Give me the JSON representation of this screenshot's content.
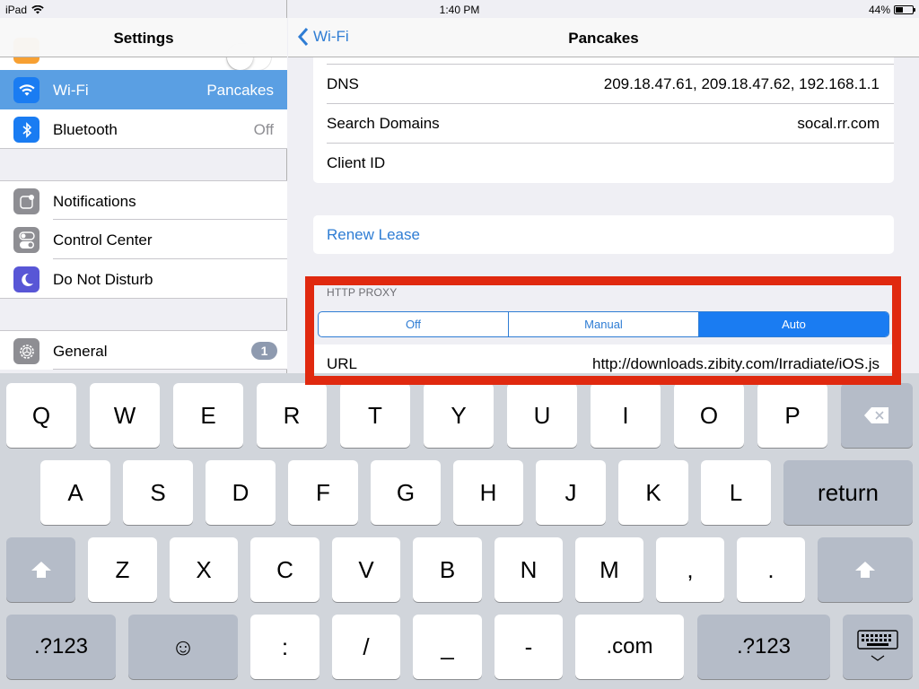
{
  "status_bar": {
    "device": "iPad",
    "time": "1:40 PM",
    "battery_percent_label": "44%",
    "battery_level": 0.44
  },
  "sidebar": {
    "title": "Settings",
    "items": [
      {
        "label": "Wi-Fi",
        "value": "Pancakes",
        "icon": "wifi-icon",
        "color": "#1a7cf2",
        "selected": true
      },
      {
        "label": "Bluetooth",
        "value": "Off",
        "icon": "bluetooth-icon",
        "color": "#1a7cf2"
      },
      {
        "label": "Notifications",
        "icon": "notifications-icon",
        "color": "#8e8e93"
      },
      {
        "label": "Control Center",
        "icon": "control-center-icon",
        "color": "#8e8e93"
      },
      {
        "label": "Do Not Disturb",
        "icon": "moon-icon",
        "color": "#5856d6"
      },
      {
        "label": "General",
        "badge": "1",
        "icon": "gear-icon",
        "color": "#8e8e93"
      }
    ]
  },
  "detail": {
    "back_label": "Wi-Fi",
    "title": "Pancakes",
    "rows": [
      {
        "label": "DNS",
        "value": "209.18.47.61, 209.18.47.62, 192.168.1.1"
      },
      {
        "label": "Search Domains",
        "value": "socal.rr.com"
      },
      {
        "label": "Client ID",
        "value": ""
      }
    ],
    "renew_lease": "Renew Lease",
    "http_proxy": {
      "header": "HTTP PROXY",
      "options": [
        "Off",
        "Manual",
        "Auto"
      ],
      "selected": "Auto",
      "url_label": "URL",
      "url_value": "http://downloads.zibity.com/Irradiate/iOS.js"
    },
    "highlight_color": "#e0290f"
  },
  "keyboard": {
    "row1": [
      "Q",
      "W",
      "E",
      "R",
      "T",
      "Y",
      "U",
      "I",
      "O",
      "P"
    ],
    "row2": [
      "A",
      "S",
      "D",
      "F",
      "G",
      "H",
      "J",
      "K",
      "L"
    ],
    "row3": [
      "Z",
      "X",
      "C",
      "V",
      "B",
      "N",
      "M",
      ",",
      "."
    ],
    "return_label": "return",
    "numbers_label": ".?123",
    "emoji_label": "☺",
    "row4": [
      ":",
      "/",
      "_",
      "-",
      ".com"
    ]
  }
}
